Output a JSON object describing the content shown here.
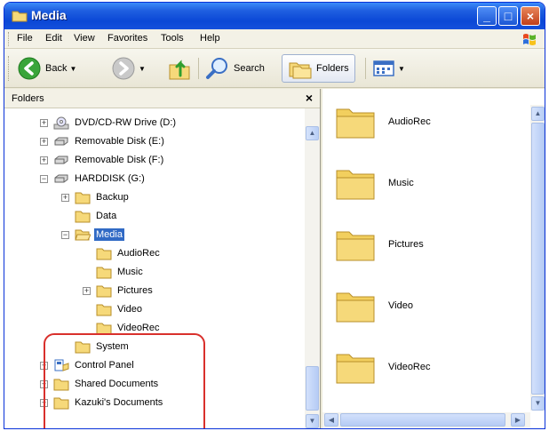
{
  "window": {
    "title": "Media"
  },
  "menu": [
    "File",
    "Edit",
    "View",
    "Favorites",
    "Tools",
    "Help"
  ],
  "toolbar": {
    "back_label": "Back",
    "search_label": "Search",
    "folders_label": "Folders"
  },
  "folders_pane": {
    "title": "Folders",
    "close_glyph": "×",
    "items": [
      {
        "label": "DVD/CD-RW Drive (D:)",
        "icon": "cd-drive-icon",
        "expander": "+"
      },
      {
        "label": "Removable Disk (E:)",
        "icon": "removable-disk-icon",
        "expander": "+"
      },
      {
        "label": "Removable Disk (F:)",
        "icon": "removable-disk-icon",
        "expander": "+"
      },
      {
        "label": "HARDDISK (G:)",
        "icon": "hard-disk-icon",
        "expander": "−"
      },
      {
        "label": "Backup",
        "icon": "folder-icon",
        "expander": "+"
      },
      {
        "label": "Data",
        "icon": "folder-icon",
        "expander": ""
      },
      {
        "label": "Media",
        "icon": "open-folder-icon",
        "expander": "−",
        "selected": true
      },
      {
        "label": "AudioRec",
        "icon": "folder-icon",
        "expander": ""
      },
      {
        "label": "Music",
        "icon": "folder-icon",
        "expander": ""
      },
      {
        "label": "Pictures",
        "icon": "folder-icon",
        "expander": "+"
      },
      {
        "label": "Video",
        "icon": "folder-icon",
        "expander": ""
      },
      {
        "label": "VideoRec",
        "icon": "folder-icon",
        "expander": ""
      },
      {
        "label": "System",
        "icon": "folder-icon",
        "expander": ""
      },
      {
        "label": "Control Panel",
        "icon": "control-panel-icon",
        "expander": "+"
      },
      {
        "label": "Shared Documents",
        "icon": "folder-icon",
        "expander": "+"
      },
      {
        "label": "Kazuki's Documents",
        "icon": "folder-icon",
        "expander": "+"
      }
    ]
  },
  "content_pane": {
    "items": [
      "AudioRec",
      "Music",
      "Pictures",
      "Video",
      "VideoRec"
    ]
  },
  "colors": {
    "titlebar": "#0a47d6",
    "selection": "#316ac5",
    "highlight_box": "#d9302c",
    "folder": "#f6d97a"
  }
}
